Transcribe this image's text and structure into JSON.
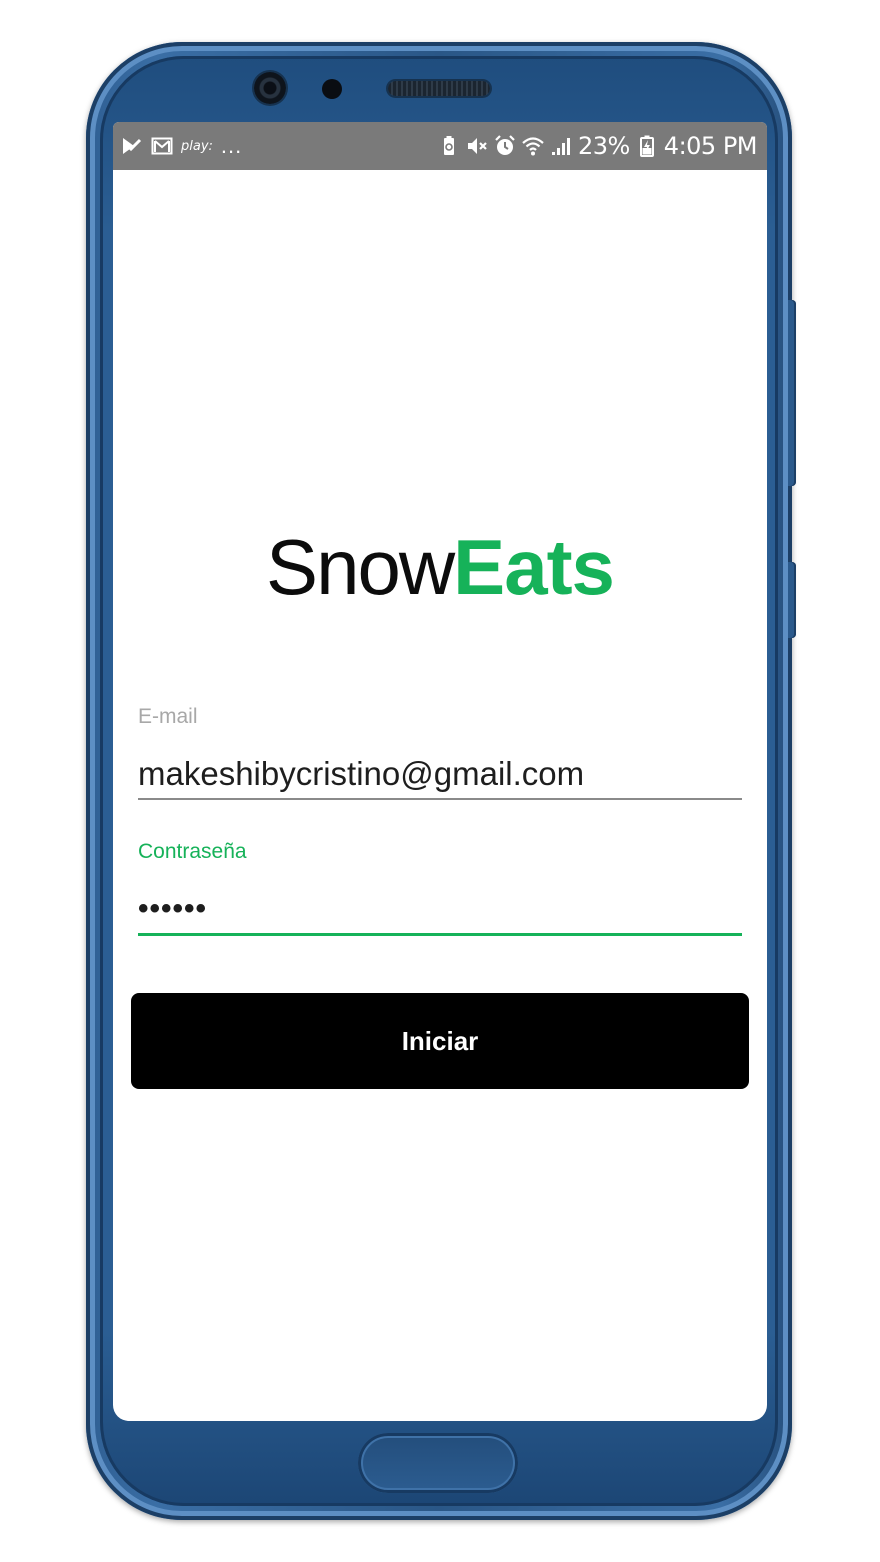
{
  "status_bar": {
    "left_icons": [
      "check-notification-icon",
      "gmail-icon"
    ],
    "play_label": "play:",
    "more_indicator": "...",
    "right_icons": [
      "battery-saver-icon",
      "mute-icon",
      "alarm-icon",
      "wifi-icon",
      "signal-icon",
      "battery-charging-icon"
    ],
    "battery_percent": "23%",
    "time": "4:05 PM",
    "background": "#7a7a7a"
  },
  "logo": {
    "part1": "Snow",
    "part2": "Eats",
    "accent_color": "#16b259"
  },
  "login": {
    "email_label": "E-mail",
    "email_value": "makeshibycristino@gmail.com",
    "password_label": "Contraseña",
    "password_mask": "••••••",
    "submit_label": "Iniciar"
  },
  "colors": {
    "accent": "#16b259",
    "button": "#000000",
    "phone_frame": "#2b5e93"
  }
}
